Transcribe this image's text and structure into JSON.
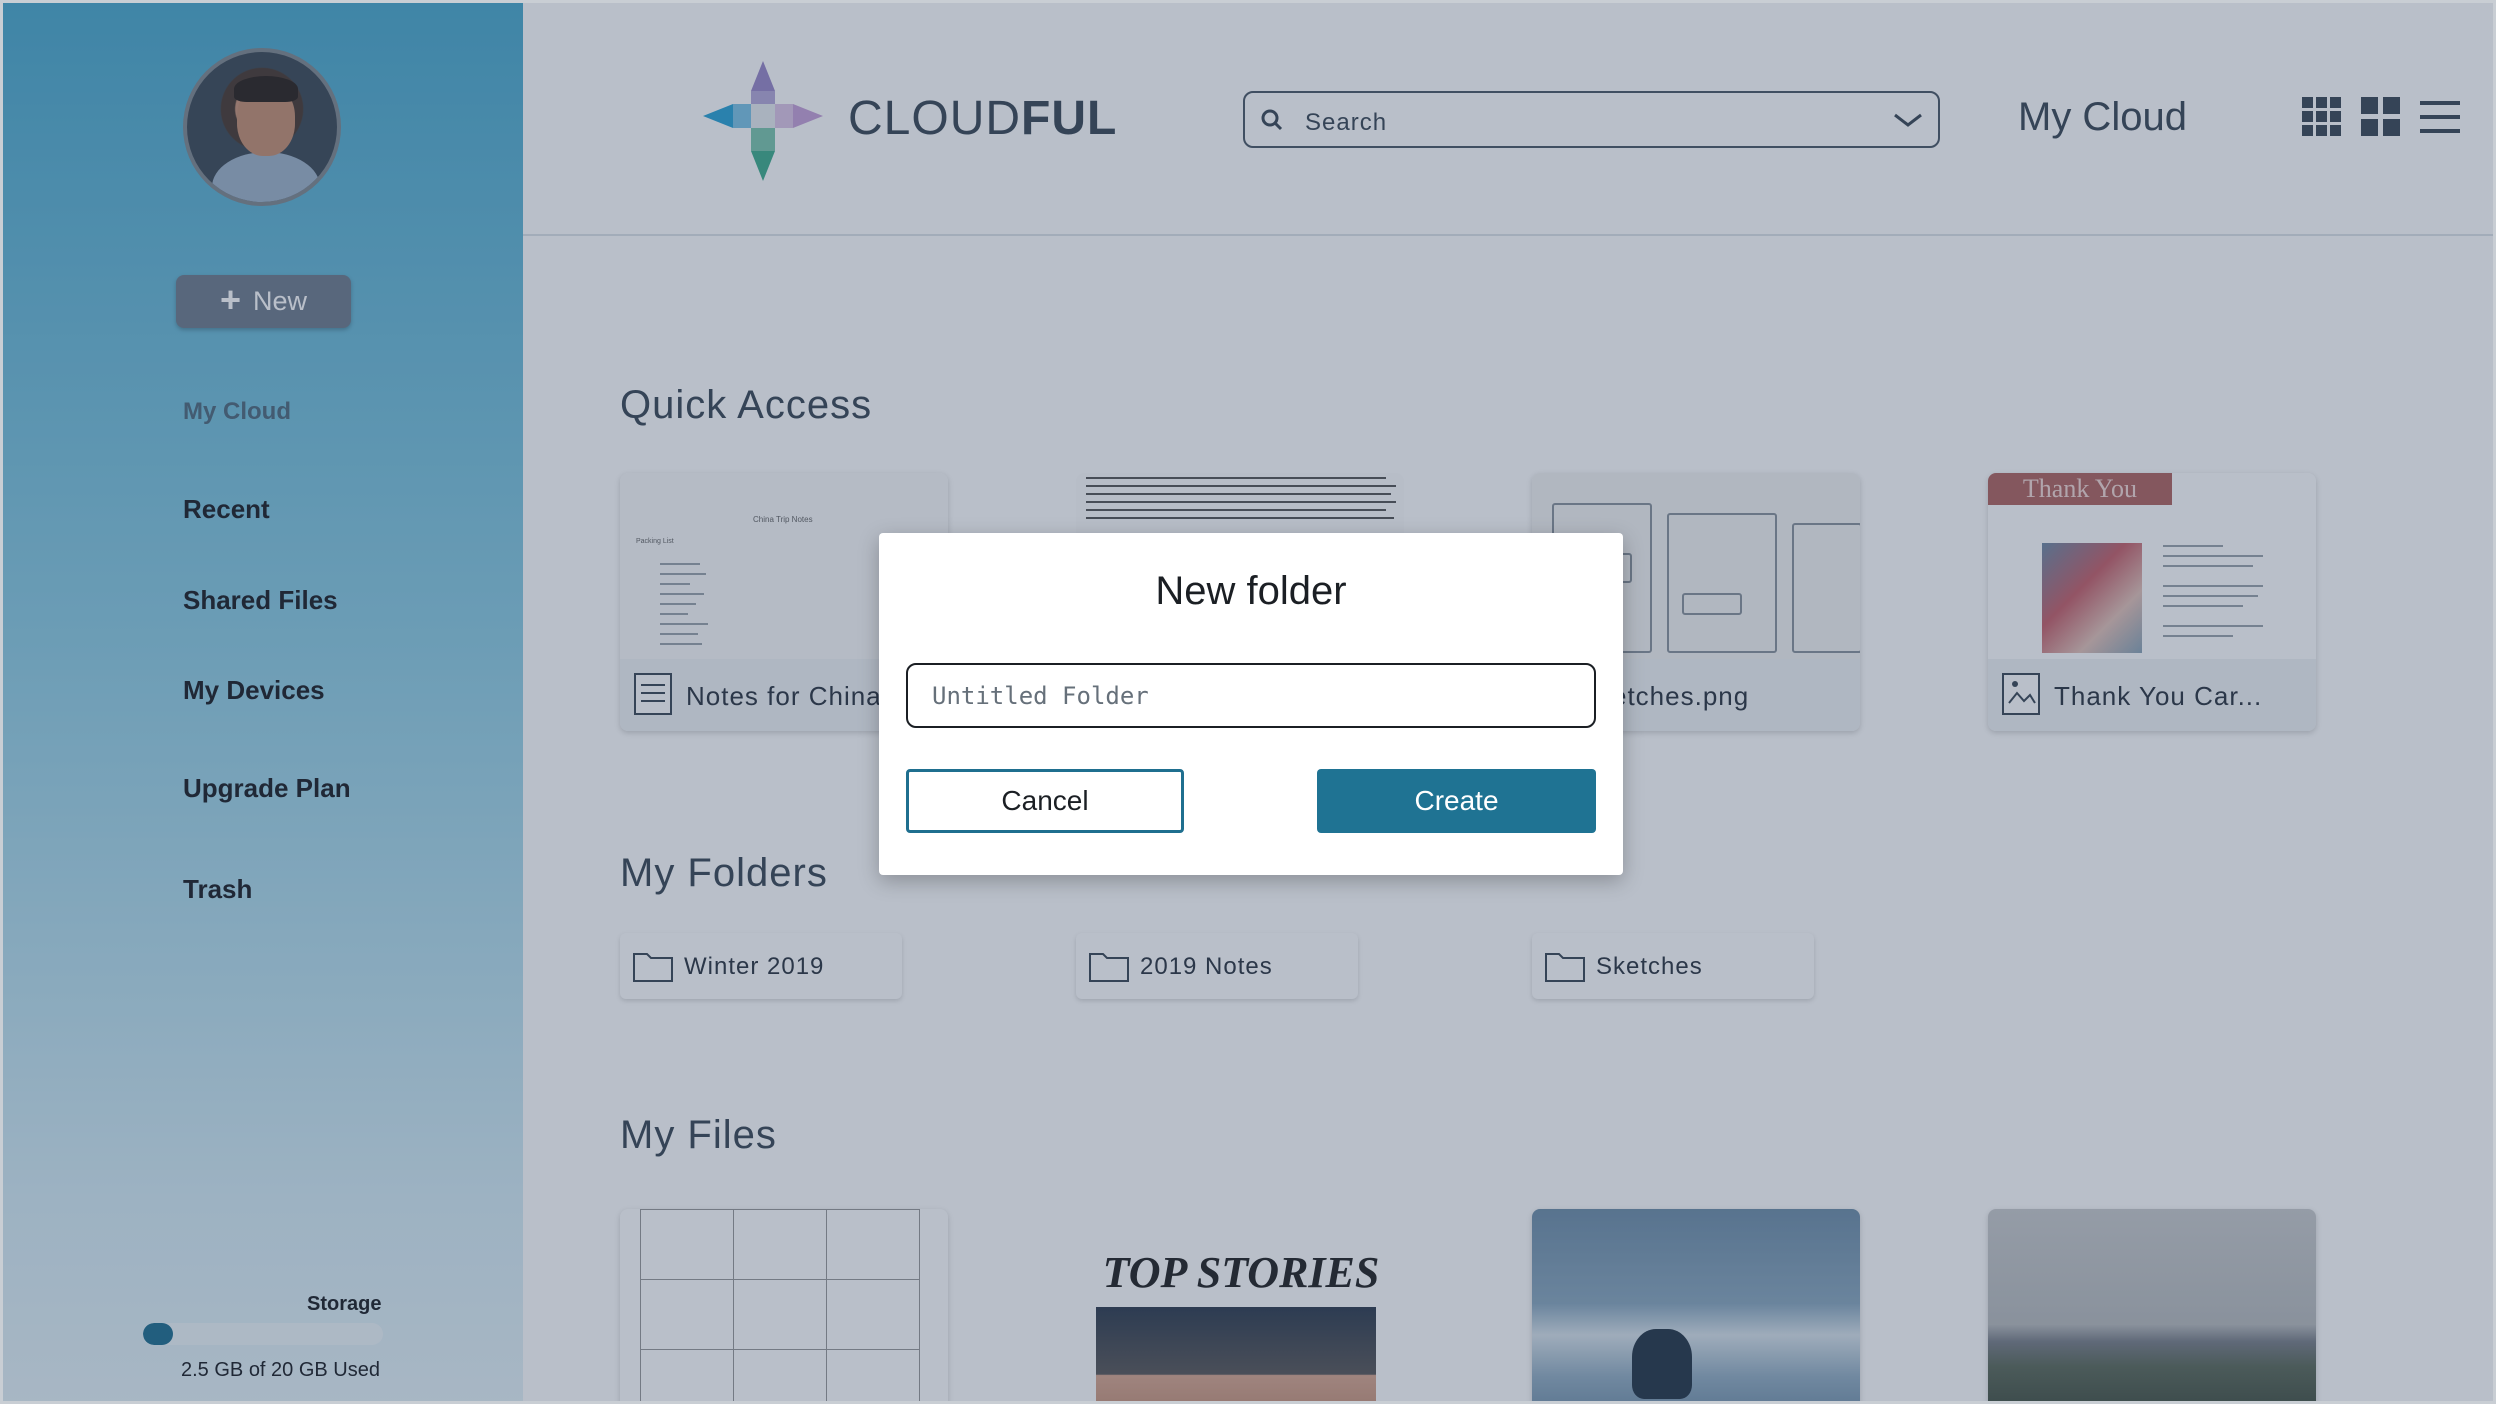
{
  "brand": {
    "prefix": "CLOUD",
    "suffix": "FUL"
  },
  "header": {
    "search_placeholder": "Search",
    "page_heading": "My Cloud"
  },
  "sidebar": {
    "new_label": "New",
    "items": [
      {
        "label": "My Cloud"
      },
      {
        "label": "Recent"
      },
      {
        "label": "Shared Files"
      },
      {
        "label": "My Devices"
      },
      {
        "label": "Upgrade Plan"
      },
      {
        "label": "Trash"
      }
    ],
    "storage": {
      "label": "Storage",
      "used_text": "2.5 GB of 20 GB Used",
      "used_fraction": 0.125
    }
  },
  "sections": {
    "quick_access": "Quick Access",
    "my_folders": "My Folders",
    "my_files": "My Files"
  },
  "quick_access": [
    {
      "name": "Notes for China"
    },
    {
      "name": ""
    },
    {
      "name": "etches.png"
    },
    {
      "name": "Thank You Car..."
    }
  ],
  "thumb_text": {
    "china_heading": "China Trip Notes",
    "packing_list": "Packing List",
    "thank_you": "Thank You",
    "top_stories": "TOP STORIES"
  },
  "folders": [
    {
      "name": "Winter 2019"
    },
    {
      "name": "2019 Notes"
    },
    {
      "name": "Sketches"
    }
  ],
  "modal": {
    "title": "New folder",
    "input_placeholder": "Untitled Folder",
    "cancel_label": "Cancel",
    "create_label": "Create"
  },
  "colors": {
    "accent": "#1f7393",
    "sidebar_top": "#4aa9cc",
    "overlay": "#2b3e5c"
  }
}
